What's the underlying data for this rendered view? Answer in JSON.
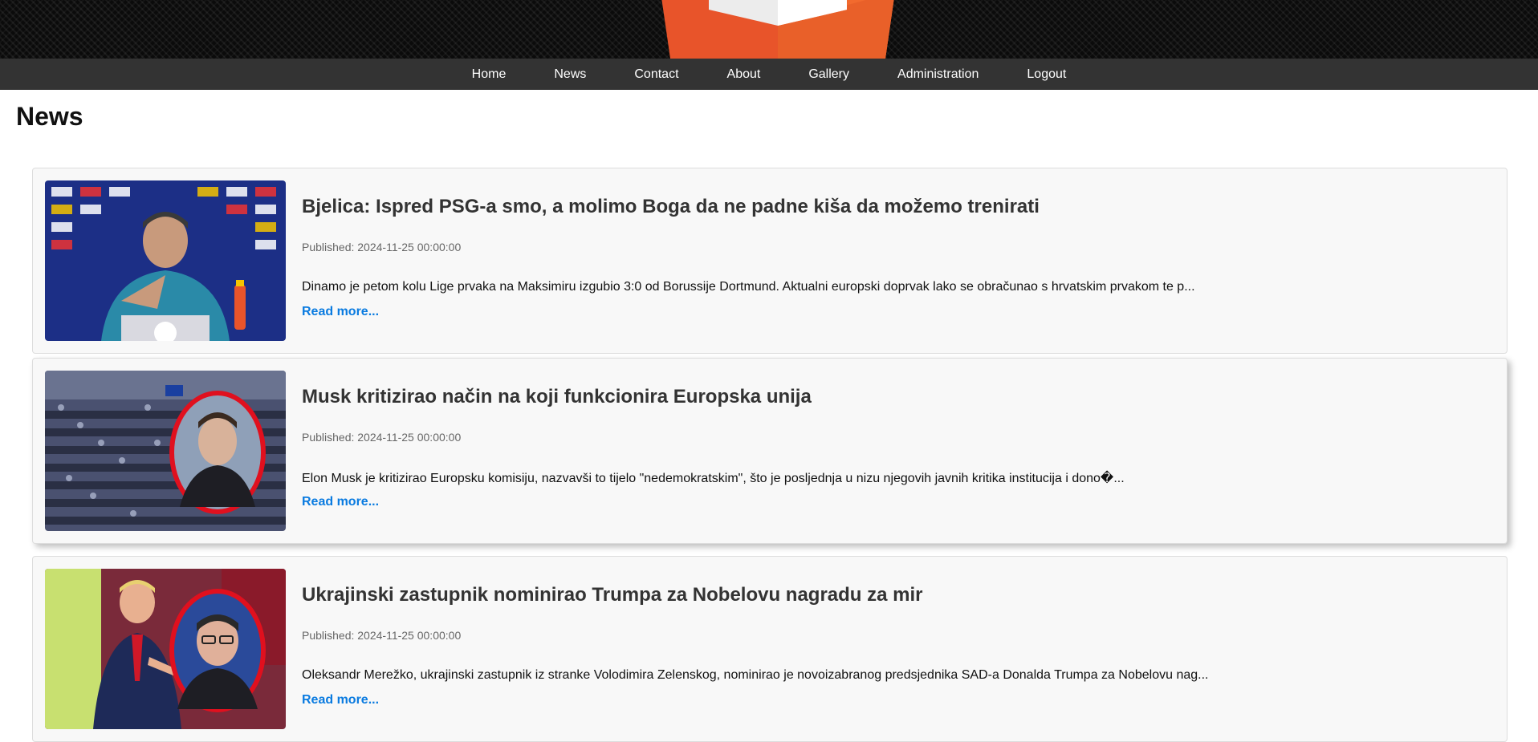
{
  "nav": {
    "items": [
      {
        "label": "Home"
      },
      {
        "label": "News"
      },
      {
        "label": "Contact"
      },
      {
        "label": "About"
      },
      {
        "label": "Gallery"
      },
      {
        "label": "Administration"
      },
      {
        "label": "Logout"
      }
    ]
  },
  "page": {
    "title": "News"
  },
  "articles": [
    {
      "title": "Bjelica: Ispred PSG-a smo, a molimo Boga da ne padne kiša da možemo trenirati",
      "published": "Published: 2024-11-25 00:00:00",
      "excerpt": "Dinamo je petom kolu Lige prvaka na Maksimiru izgubio 3:0 od Borussije Dortmund. Aktualni europski doprvak lako se obračunao s hrvatskim prvakom te p...",
      "link": "Read more...",
      "image": "press-conference-coach"
    },
    {
      "title": "Musk kritizirao način na koji funkcionira Europska unija",
      "published": "Published: 2024-11-25 00:00:00",
      "excerpt": "Elon Musk je kritizirao Europsku komisiju, nazvavši to tijelo \"nedemokratskim\", što je posljednja u nizu njegovih javnih kritika institucija i dono�...",
      "link": "Read more...",
      "image": "european-parliament-with-portrait-inset"
    },
    {
      "title": "Ukrajinski zastupnik nominirao Trumpa za Nobelovu nagradu za mir",
      "published": "Published: 2024-11-25 00:00:00",
      "excerpt": "Oleksandr Merežko, ukrajinski zastupnik iz stranke Volodimira Zelenskog, nominirao je novoizabranog predsjednika SAD-a Donalda Trumpa za Nobelovu nag...",
      "link": "Read more...",
      "image": "politician-with-portrait-inset"
    }
  ],
  "colors": {
    "navbar": "#333333",
    "link": "#0a7be0",
    "logo_orange": "#e8542a",
    "inset_ring": "#e0101e"
  }
}
